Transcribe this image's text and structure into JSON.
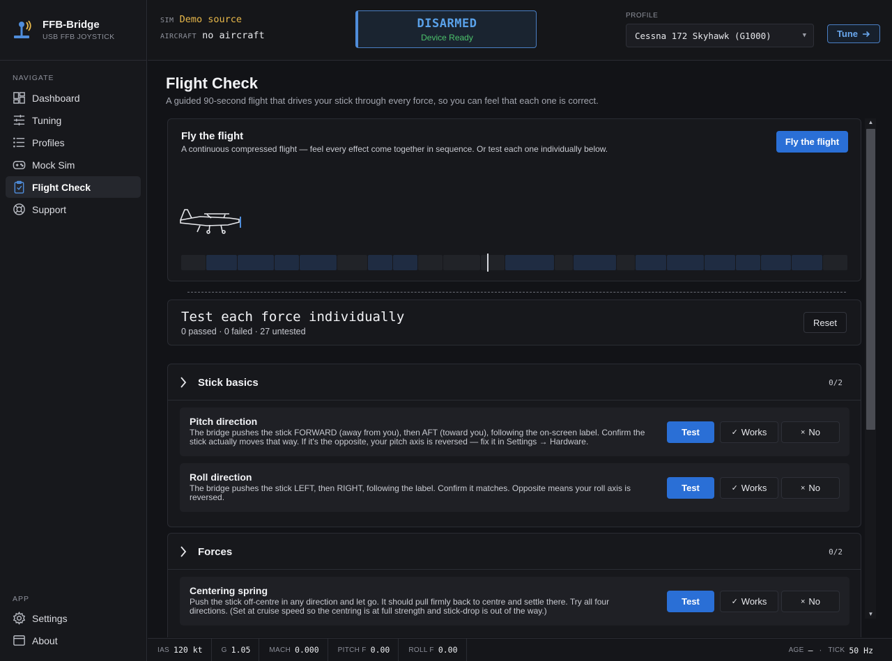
{
  "brand": {
    "title": "FFB-Bridge",
    "subtitle": "USB FFB JOYSTICK"
  },
  "nav": {
    "section": "NAVIGATE",
    "items": [
      {
        "label": "Dashboard",
        "icon": "dashboard-icon"
      },
      {
        "label": "Tuning",
        "icon": "sliders-icon"
      },
      {
        "label": "Profiles",
        "icon": "list-icon"
      },
      {
        "label": "Mock Sim",
        "icon": "gamepad-icon"
      },
      {
        "label": "Flight Check",
        "icon": "clipboard-check-icon",
        "active": true
      },
      {
        "label": "Support",
        "icon": "lifebuoy-icon"
      }
    ]
  },
  "app_nav": {
    "section": "APP",
    "items": [
      {
        "label": "Settings",
        "icon": "gear-icon"
      },
      {
        "label": "About",
        "icon": "window-icon"
      }
    ]
  },
  "topbar": {
    "sim_label": "SIM",
    "sim_value": "Demo source",
    "aircraft_label": "AIRCRAFT",
    "aircraft_value": "no aircraft",
    "arm_state": "DISARMED",
    "arm_sub": "Device Ready",
    "profile_label": "PROFILE",
    "profile_value": "Cessna 172 Skyhawk (G1000)",
    "tune_label": "Tune"
  },
  "page": {
    "title": "Flight Check",
    "subtitle": "A guided 90-second flight that drives your stick through every force, so you can feel that each one is correct."
  },
  "flight": {
    "title": "Fly the flight",
    "subtitle": "A continuous compressed flight — feel every effect come together in sequence. Or test each one individually below.",
    "button": "Fly the flight"
  },
  "tests": {
    "title": "Test each force individually",
    "summary": "0 passed · 0 failed · 27 untested",
    "reset": "Reset"
  },
  "groups": [
    {
      "name": "Stick basics",
      "count": "0/2",
      "rows": [
        {
          "name": "Pitch direction",
          "desc": "The bridge pushes the stick FORWARD (away from you), then AFT (toward you), following the on-screen label. Confirm the stick actually moves that way. If it's the opposite, your pitch axis is reversed — fix it in Settings → Hardware."
        },
        {
          "name": "Roll direction",
          "desc": "The bridge pushes the stick LEFT, then RIGHT, following the label. Confirm it matches. Opposite means your roll axis is reversed."
        }
      ]
    },
    {
      "name": "Forces",
      "count": "0/2",
      "rows": [
        {
          "name": "Centering spring",
          "desc": "Push the stick off-centre in any direction and let go. It should pull firmly back to centre and settle there. Try all four directions. (Set at cruise speed so the centring is at full strength and stick-drop is out of the way.)"
        }
      ]
    }
  ],
  "row_buttons": {
    "test": "Test",
    "works": "Works",
    "no": "No",
    "works_symbol": "✓",
    "no_symbol": "×"
  },
  "status": {
    "ias_label": "IAS",
    "ias_value": "120 kt",
    "g_label": "G",
    "g_value": "1.05",
    "mach_label": "MACH",
    "mach_value": "0.000",
    "pitchf_label": "PITCH F",
    "pitchf_value": "0.00",
    "rollf_label": "ROLL F",
    "rollf_value": "0.00",
    "age_label": "AGE",
    "age_value": "—",
    "age_sep": "·",
    "tick_label": "TICK",
    "tick_value": "50 Hz"
  },
  "colors": {
    "accent": "#2a6fd6",
    "armed_border": "#4f8ddb",
    "ready": "#4cc36c",
    "sim": "#e8b84a"
  }
}
